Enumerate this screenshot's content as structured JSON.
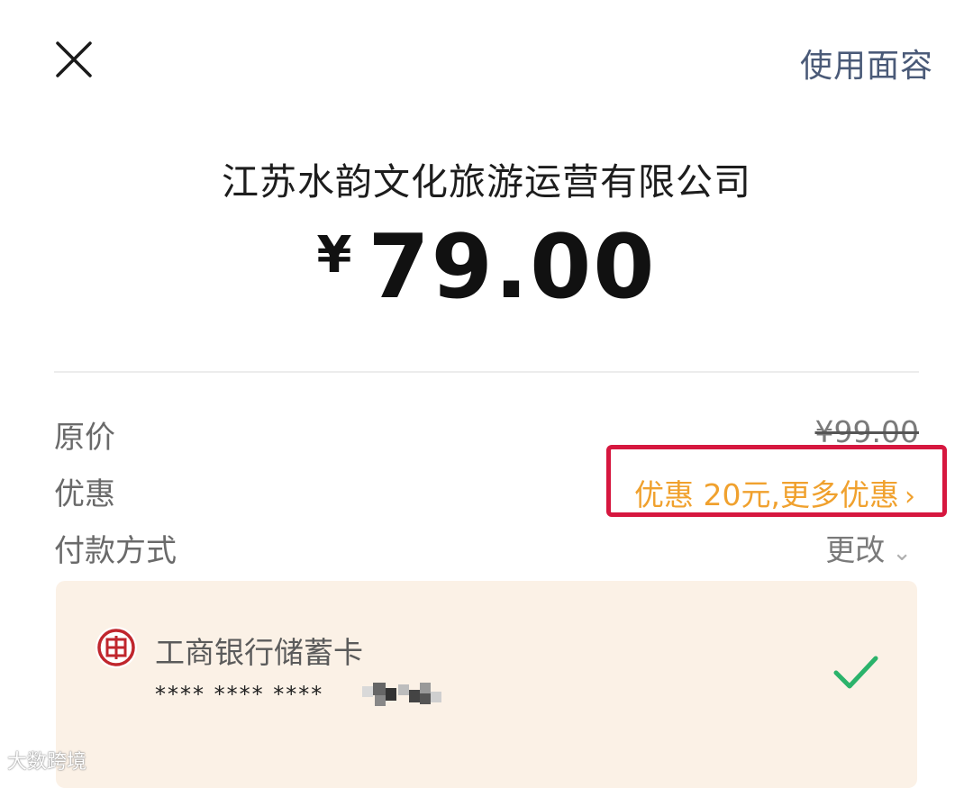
{
  "header": {
    "close_icon": "close-icon",
    "face_label": "使用面容"
  },
  "payment": {
    "merchant": "江苏水韵文化旅游运营有限公司",
    "currency": "¥",
    "amount": "79.00"
  },
  "details": {
    "original_label": "原价",
    "original_value": "¥99.00",
    "discount_label": "优惠",
    "discount_value": "优惠 20元,更多优惠",
    "discount_chevron": "›",
    "method_label": "付款方式",
    "method_change": "更改",
    "method_chevron": "⌄"
  },
  "card": {
    "bank_icon": "icbc-logo-icon",
    "name": "工商银行储蓄卡",
    "masked_number": "**** **** ****",
    "selected_icon": "check-icon"
  },
  "colors": {
    "accent_link": "#4a5a78",
    "discount": "#f0a12e",
    "highlight": "#d6173f",
    "card_bg": "#fbf1e6",
    "check": "#2bb36b",
    "bank_red": "#c0262d"
  },
  "watermark": "大数跨境"
}
